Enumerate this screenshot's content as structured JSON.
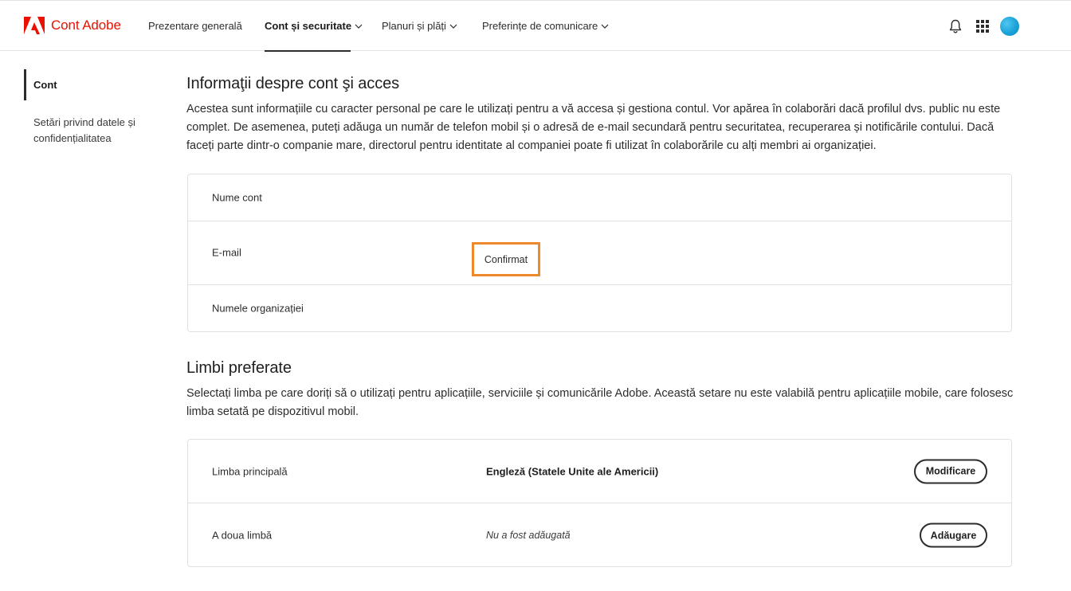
{
  "header": {
    "brand": "Cont Adobe",
    "nav": [
      {
        "label": "Prezentare generală",
        "has_dropdown": false,
        "active": false
      },
      {
        "label": "Cont și securitate",
        "has_dropdown": true,
        "active": true
      },
      {
        "label": "Planuri și plăți",
        "has_dropdown": true,
        "active": false
      },
      {
        "label": "Preferințe de comunicare",
        "has_dropdown": true,
        "active": false
      }
    ],
    "icons": [
      "bell-icon",
      "apps-grid-icon",
      "avatar"
    ]
  },
  "sidebar": {
    "items": [
      {
        "label": "Cont",
        "active": true
      },
      {
        "label": "Setări privind datele și confidențialitatea",
        "active": false
      }
    ]
  },
  "account_section": {
    "title": "Informaţii despre cont şi acces",
    "description": "Acestea sunt informațiile cu caracter personal pe care le utilizați pentru a vă accesa și gestiona contul. Vor apărea în colaborări dacă profilul dvs. public nu este complet. De asemenea, puteți adăuga un număr de telefon mobil și o adresă de e-mail secundară pentru securitatea, recuperarea și notificările contului. Dacă faceți parte dintr-o companie mare, directorul pentru identitate al companiei poate fi utilizat în colaborările cu alți membri ai organizației.",
    "rows": [
      {
        "label": "Nume cont"
      },
      {
        "label": "E-mail",
        "badge": "Confirmat"
      },
      {
        "label": "Numele organizației"
      }
    ]
  },
  "language_section": {
    "title": "Limbi preferate",
    "description": "Selectați limba pe care doriți să o utilizați pentru aplicațiile, serviciile și comunicările Adobe. Această setare nu este valabilă pentru aplicațiile mobile, care folosesc limba setată pe dispozitivul mobil.",
    "rows": [
      {
        "label": "Limba principală",
        "value": "Engleză (Statele Unite ale Americii)",
        "button": "Modificare"
      },
      {
        "label": "A doua limbă",
        "value": "Nu a fost adăugată",
        "button": "Adăugare"
      }
    ]
  },
  "colors": {
    "brand_red": "#eb1000",
    "highlight_orange": "#ef8a2c",
    "avatar_blue": "#1aa3d9"
  }
}
